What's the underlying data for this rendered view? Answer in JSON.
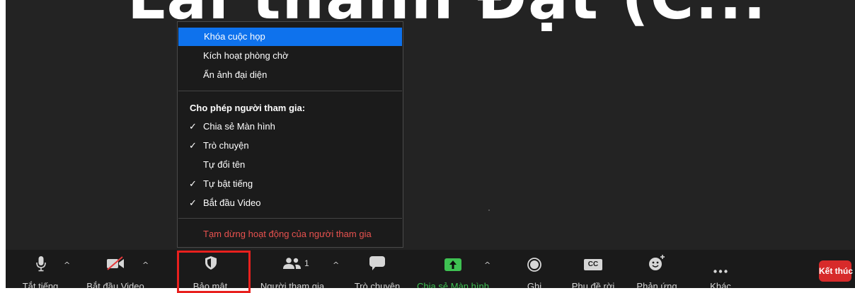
{
  "participant_name_fragment": "Lại thành Đạt (C...",
  "security_menu": {
    "items": [
      {
        "label": "Khóa cuộc họp",
        "selected": true
      },
      {
        "label": "Kích hoạt phòng chờ"
      },
      {
        "label": "Ẩn ảnh đại diện"
      }
    ],
    "allow_header": "Cho phép người tham gia:",
    "permissions": [
      {
        "label": "Chia sẻ Màn hình",
        "check": "✓"
      },
      {
        "label": "Trò chuyện",
        "check": "✓"
      },
      {
        "label": "Tự đổi tên",
        "check": ""
      },
      {
        "label": "Tự bật tiếng",
        "check": "✓"
      },
      {
        "label": "Bắt đầu Video",
        "check": "✓"
      }
    ],
    "suspend_label": "Tạm dừng hoạt động của người tham gia"
  },
  "toolbar": {
    "mute": "Tắt tiếng",
    "start_video": "Bắt đầu Video",
    "security": "Bảo mật",
    "participants": "Người tham gia",
    "participants_count": "1",
    "chat": "Trò chuyện",
    "share_screen": "Chia sẻ Màn hình",
    "record": "Ghi",
    "captions": "Phụ đề rời",
    "captions_badge": "CC",
    "reactions": "Phản ứng",
    "more": "Khác",
    "end": "Kết thúc"
  },
  "icons": {
    "mute": "microphone-icon",
    "video": "video-off-icon",
    "security": "shield-icon",
    "participants": "participants-icon",
    "chat": "chat-bubble-icon",
    "share": "share-screen-arrow-icon",
    "record": "record-icon",
    "captions": "closed-captions-icon",
    "reactions": "emoji-add-icon",
    "more": "ellipsis-icon"
  },
  "colors": {
    "selection": "#0e72ed",
    "share_green": "#3ec152",
    "end_red": "#d72a2a",
    "highlight_red": "#e8201e",
    "suspend_text": "#e8524f"
  }
}
